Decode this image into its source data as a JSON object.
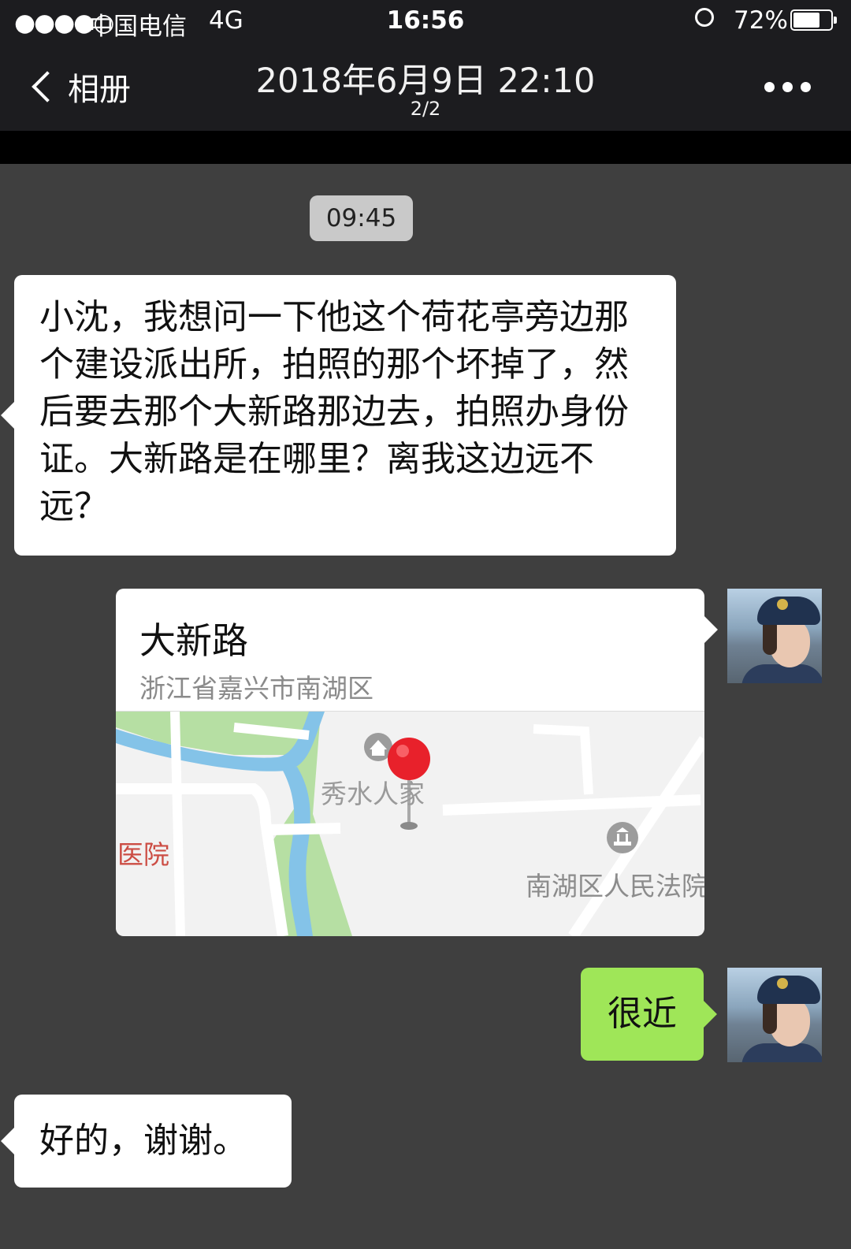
{
  "status_bar": {
    "signal": "●●●●○",
    "carrier": "中国电信",
    "network": "4G",
    "time": "16:56",
    "battery": "72%",
    "battery_level": 0.72
  },
  "nav": {
    "back_label": "相册",
    "title": "2018年6月9日 22:10",
    "subtitle": "2/2"
  },
  "chat": {
    "timestamp": "09:45",
    "message1": "小沈，我想问一下他这个荷花亭旁边那个建设派出所，拍照的那个坏掉了，然后要去那个大新路那边去，拍照办身份证。大新路是在哪里？离我这边远不远？",
    "location_card": {
      "title": "大新路",
      "address": "浙江省嘉兴市南湖区",
      "map_labels": {
        "poi_residence": "秀水人家",
        "poi_hospital": "医院",
        "poi_court": "南湖区人民法院"
      }
    },
    "message2": "很近",
    "message3": "好的，谢谢。"
  },
  "colors": {
    "bar_bg": "#1c1c1f",
    "chat_bg": "#3f3f3f",
    "sent_bubble": "#9fe658",
    "received_bubble": "#ffffff",
    "pin": "#e8212b"
  }
}
